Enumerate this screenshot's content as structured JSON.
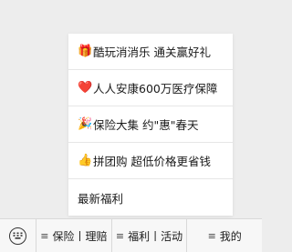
{
  "popup_menu": {
    "items": [
      {
        "icon": "gift-icon",
        "glyph": "🎁",
        "label": "酷玩消消乐 通关赢好礼"
      },
      {
        "icon": "heart-icon",
        "glyph": "❤️",
        "label": "人人安康600万医疗保障"
      },
      {
        "icon": "party-popper-icon",
        "glyph": "🎉",
        "label": "保险大集 约\"惠\"春天"
      },
      {
        "icon": "thumbs-up-icon",
        "glyph": "👍",
        "label": "拼团购 超低价格更省钱"
      },
      {
        "icon": "",
        "glyph": "",
        "label": "最新福利"
      }
    ]
  },
  "bottom_bar": {
    "keyboard_icon": "keyboard-icon",
    "tabs": [
      {
        "icon": "menu-icon",
        "glyph": "≡",
        "label": "保险丨理赔"
      },
      {
        "icon": "menu-icon",
        "glyph": "≡",
        "label": "福利丨活动"
      },
      {
        "icon": "menu-icon",
        "glyph": "≡",
        "label": "我的"
      }
    ]
  },
  "colors": {
    "background": "#ededed",
    "menu_background": "#ffffff",
    "bar_background": "#f7f7f7",
    "divider": "#d9d9d9",
    "text": "#1a1a1a"
  }
}
